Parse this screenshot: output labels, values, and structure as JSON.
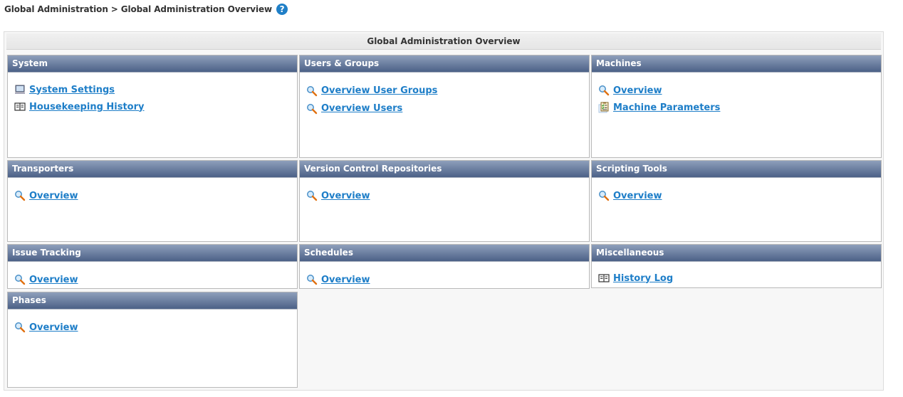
{
  "breadcrumb": {
    "items": [
      "Global Administration",
      "Global Administration Overview"
    ],
    "separator": ">",
    "help_icon": "question-circle-icon",
    "help_glyph": "?"
  },
  "overview": {
    "title": "Global Administration Overview",
    "panels": [
      {
        "title": "System",
        "links": [
          {
            "label": "System Settings",
            "icon": "computer-icon"
          },
          {
            "label": "Housekeeping History",
            "icon": "book-icon"
          }
        ]
      },
      {
        "title": "Users & Groups",
        "links": [
          {
            "label": "Overview User Groups",
            "icon": "magnifier-icon"
          },
          {
            "label": "Overview Users",
            "icon": "magnifier-icon"
          }
        ]
      },
      {
        "title": "Machines",
        "links": [
          {
            "label": "Overview",
            "icon": "magnifier-icon"
          },
          {
            "label": "Machine Parameters",
            "icon": "clipboard-icon"
          }
        ]
      },
      {
        "title": "Transporters",
        "links": [
          {
            "label": "Overview",
            "icon": "magnifier-icon"
          }
        ]
      },
      {
        "title": "Version Control Repositories",
        "links": [
          {
            "label": "Overview",
            "icon": "magnifier-icon"
          }
        ]
      },
      {
        "title": "Scripting Tools",
        "links": [
          {
            "label": "Overview",
            "icon": "magnifier-icon"
          }
        ]
      },
      {
        "title": "Issue Tracking",
        "links": [
          {
            "label": "Overview",
            "icon": "magnifier-icon"
          }
        ]
      },
      {
        "title": "Schedules",
        "links": [
          {
            "label": "Overview",
            "icon": "magnifier-icon"
          }
        ]
      },
      {
        "title": "Miscellaneous",
        "links": [
          {
            "label": "History Log",
            "icon": "book-icon"
          }
        ]
      },
      {
        "title": "Phases",
        "links": [
          {
            "label": "Overview",
            "icon": "magnifier-icon"
          }
        ]
      }
    ]
  },
  "colors": {
    "link": "#1e7ec8",
    "header_top": "#8e9fbb",
    "header_bottom": "#4c6187",
    "help": "#1f7fc7"
  }
}
